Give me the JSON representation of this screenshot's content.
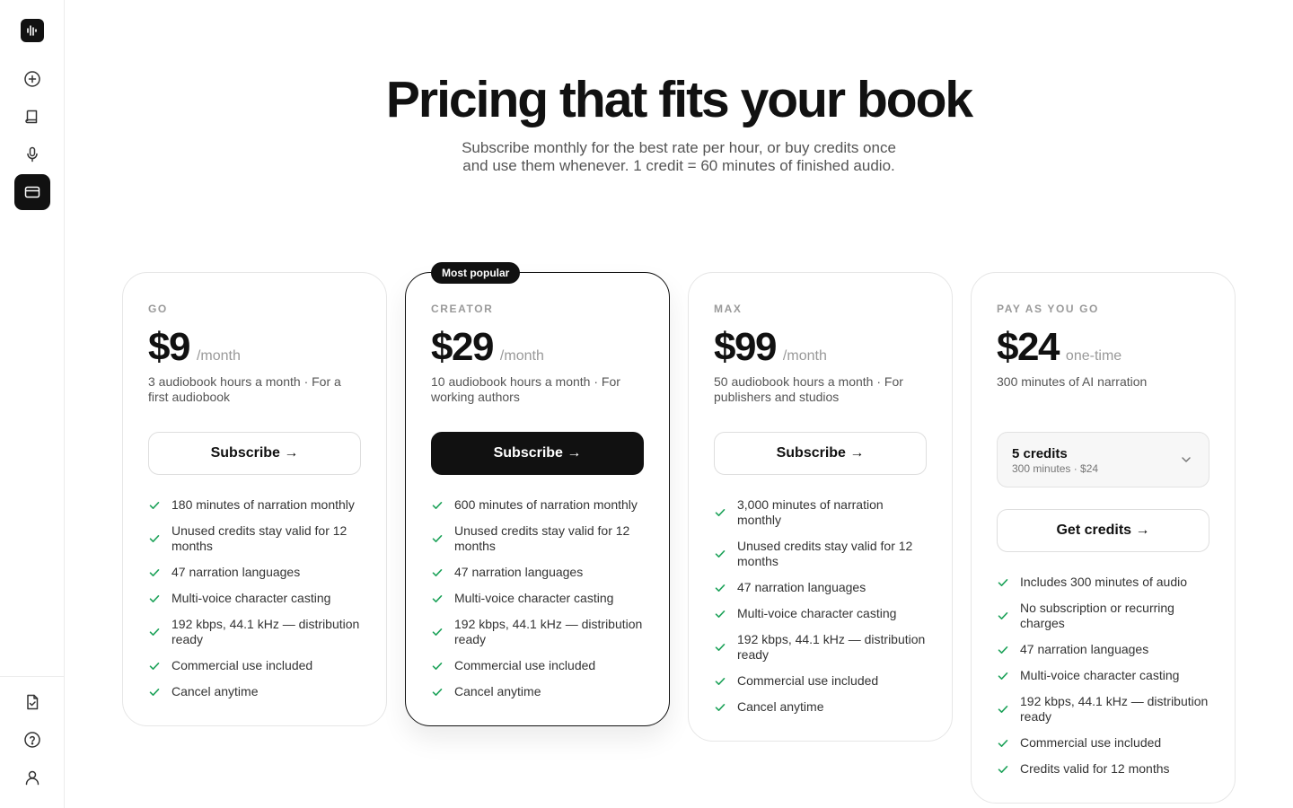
{
  "sidebar": {
    "items": [
      {
        "icon": "plus-circle-icon"
      },
      {
        "icon": "book-icon"
      },
      {
        "icon": "microphone-icon"
      },
      {
        "icon": "credit-card-icon",
        "active": true
      }
    ],
    "bottom_items": [
      {
        "icon": "file-check-icon"
      },
      {
        "icon": "help-circle-icon"
      },
      {
        "icon": "user-icon"
      }
    ]
  },
  "header": {
    "title": "Pricing that fits your book",
    "subtitle": "Subscribe monthly for the best rate per hour, or buy credits once and use them whenever. 1 credit = 60 minutes of finished audio."
  },
  "colors": {
    "accent": "#111111",
    "check": "#1fa35b",
    "muted": "#9a9a9a"
  },
  "plans": [
    {
      "tier": "GO",
      "price": "$9",
      "period": "/month",
      "description": "3 audiobook hours a month · For a first audiobook",
      "cta": "Subscribe →",
      "features": [
        "180 minutes of narration monthly",
        "Unused credits stay valid for 12 months",
        "47 narration languages",
        "Multi-voice character casting",
        "192 kbps, 44.1 kHz — distribution ready",
        "Commercial use included",
        "Cancel anytime"
      ]
    },
    {
      "tier": "CREATOR",
      "badge": "Most popular",
      "price": "$29",
      "period": "/month",
      "description": "10 audiobook hours a month · For working authors",
      "cta": "Subscribe →",
      "features": [
        "600 minutes of narration monthly",
        "Unused credits stay valid for 12 months",
        "47 narration languages",
        "Multi-voice character casting",
        "192 kbps, 44.1 kHz — distribution ready",
        "Commercial use included",
        "Cancel anytime"
      ]
    },
    {
      "tier": "MAX",
      "price": "$99",
      "period": "/month",
      "description": "50 audiobook hours a month · For publishers and studios",
      "cta": "Subscribe →",
      "features": [
        "3,000 minutes of narration monthly",
        "Unused credits stay valid for 12 months",
        "47 narration languages",
        "Multi-voice character casting",
        "192 kbps, 44.1 kHz — distribution ready",
        "Commercial use included",
        "Cancel anytime"
      ]
    },
    {
      "tier": "PAY AS YOU GO",
      "price": "$24",
      "period": "one-time",
      "description": "300 minutes of AI narration",
      "select": {
        "value": "5 credits",
        "detail": "300 minutes · $24"
      },
      "cta": "Get credits →",
      "features": [
        "Includes 300 minutes of audio",
        "No subscription or recurring charges",
        "47 narration languages",
        "Multi-voice character casting",
        "192 kbps, 44.1 kHz — distribution ready",
        "Commercial use included",
        "Credits valid for 12 months"
      ]
    }
  ]
}
